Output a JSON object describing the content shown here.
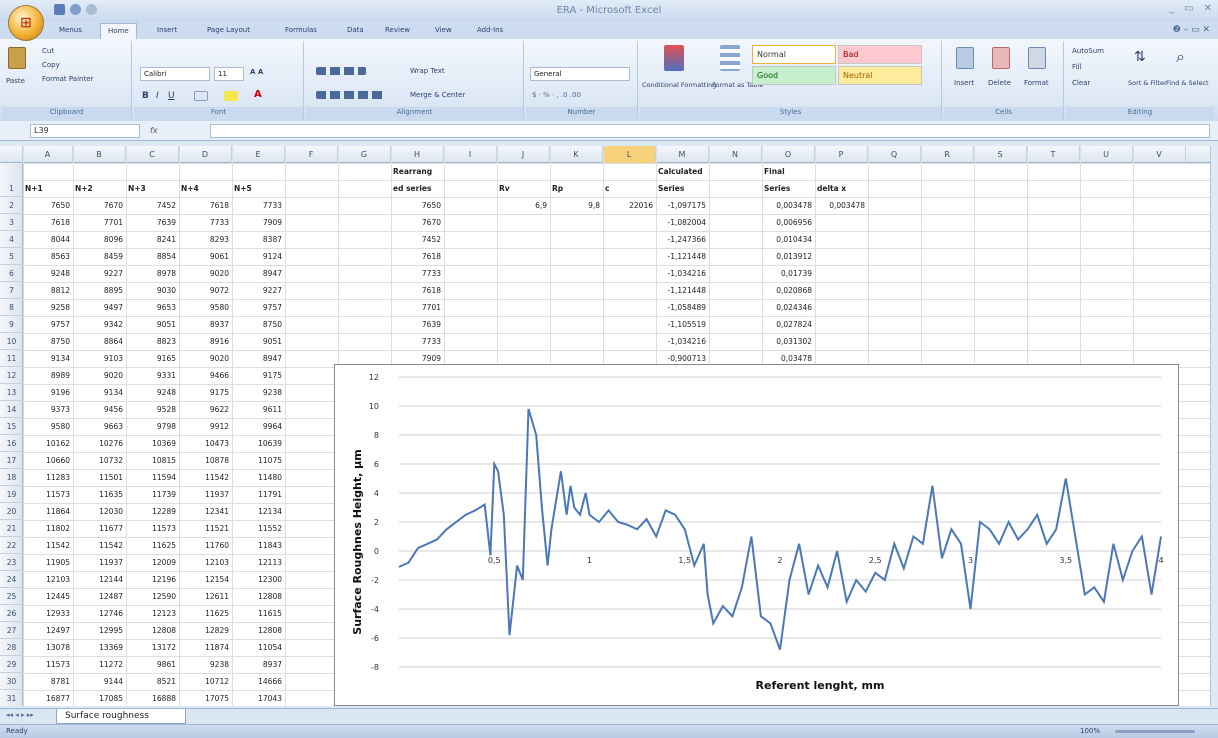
{
  "window": {
    "title": "ERA - Microsoft Excel"
  },
  "tabs": [
    "Menus",
    "Home",
    "Insert",
    "Page Layout",
    "Formulas",
    "Data",
    "Review",
    "View",
    "Add-Ins"
  ],
  "ribbon": {
    "clipboard": {
      "paste": "Paste",
      "cut": "Cut",
      "copy": "Copy",
      "format_painter": "Format Painter",
      "label": "Clipboard"
    },
    "font": {
      "name": "Calibri",
      "size": "11",
      "label": "Font"
    },
    "alignment": {
      "wrap": "Wrap Text",
      "merge": "Merge & Center",
      "label": "Alignment"
    },
    "number": {
      "format": "General",
      "label": "Number"
    },
    "styles": {
      "conditional": "Conditional Formatting",
      "format_table": "Format as Table",
      "normal": "Normal",
      "bad": "Bad",
      "good": "Good",
      "neutral": "Neutral",
      "label": "Styles"
    },
    "cells": {
      "insert": "Insert",
      "delete": "Delete",
      "format": "Format",
      "label": "Cells"
    },
    "editing": {
      "autosum": "AutoSum",
      "fill": "Fill",
      "clear": "Clear",
      "sort": "Sort & Filter",
      "find": "Find & Select",
      "label": "Editing"
    }
  },
  "formula_bar": {
    "name_box": "L39",
    "fx": "fx",
    "formula": ""
  },
  "columns": [
    "A",
    "B",
    "C",
    "D",
    "E",
    "F",
    "G",
    "H",
    "I",
    "J",
    "K",
    "L",
    "M",
    "N",
    "O",
    "P",
    "Q",
    "R",
    "S",
    "T",
    "U",
    "V"
  ],
  "headers": {
    "A": "N+1",
    "B": "N+2",
    "C": "N+3",
    "D": "N+4",
    "E": "N+5",
    "H1": "Rearrang",
    "H2": "ed series",
    "J": "Rv",
    "K": "Rp",
    "L": "c",
    "M1": "Calculated",
    "M2": "Series",
    "O1": "Final",
    "O2": "Series",
    "P": "delta x"
  },
  "table": [
    [
      7650,
      7670,
      7452,
      7618,
      7733
    ],
    [
      7618,
      7701,
      7639,
      7733,
      7909
    ],
    [
      8044,
      8096,
      8241,
      8293,
      8387
    ],
    [
      8563,
      8459,
      8854,
      9061,
      9124
    ],
    [
      9248,
      9227,
      8978,
      9020,
      8947
    ],
    [
      8812,
      8895,
      9030,
      9072,
      9227
    ],
    [
      9258,
      9497,
      9653,
      9580,
      9757
    ],
    [
      9757,
      9342,
      9051,
      8937,
      8750
    ],
    [
      8750,
      8864,
      8823,
      8916,
      9051
    ],
    [
      9134,
      9103,
      9165,
      9020,
      8947
    ],
    [
      8989,
      9020,
      9331,
      9466,
      9175
    ],
    [
      9196,
      9134,
      9248,
      9175,
      9238
    ],
    [
      9373,
      9456,
      9528,
      9622,
      9611
    ],
    [
      9580,
      9663,
      9798,
      9912,
      9964
    ],
    [
      10162,
      10276,
      10369,
      10473,
      10639
    ],
    [
      10660,
      10732,
      10815,
      10878,
      11075
    ],
    [
      11283,
      11501,
      11594,
      11542,
      11480
    ],
    [
      11573,
      11635,
      11739,
      11937,
      11791
    ],
    [
      11864,
      12030,
      12289,
      12341,
      12134
    ],
    [
      11802,
      11677,
      11573,
      11521,
      11552
    ],
    [
      11542,
      11542,
      11625,
      11760,
      11843
    ],
    [
      11905,
      11937,
      12009,
      12103,
      12113
    ],
    [
      12103,
      12144,
      12196,
      12154,
      12300
    ],
    [
      12445,
      12487,
      12590,
      12611,
      12808
    ],
    [
      12933,
      12746,
      12123,
      11625,
      11615
    ],
    [
      12497,
      12995,
      12808,
      12829,
      12808
    ],
    [
      13078,
      13369,
      13172,
      11874,
      11054
    ],
    [
      11573,
      11272,
      9861,
      9238,
      8937
    ],
    [
      8781,
      9144,
      8521,
      10712,
      14666
    ],
    [
      16877,
      17085,
      16888,
      17075,
      17043
    ]
  ],
  "col_h": [
    7650,
    7670,
    7452,
    7618,
    7733,
    7618,
    7701,
    7639,
    7733,
    7909
  ],
  "col_j": "6,9",
  "col_k": "9,8",
  "col_l": "22016",
  "col_m": [
    "-1,097175",
    "-1,082004",
    "-1,247366",
    "-1,121448",
    "-1,034216",
    "-1,121448",
    "-1,058489",
    "-1,105519",
    "-1,034216",
    "-0,900713"
  ],
  "col_o": [
    "0,003478",
    "0,006956",
    "0,010434",
    "0,013912",
    "0,01739",
    "0,020868",
    "0,024346",
    "0,027824",
    "0,031302",
    "0,03478"
  ],
  "col_p": "0,003478",
  "sheet_tab": "Surface roughness",
  "status": "Ready",
  "zoom": "100%",
  "chart_data": {
    "type": "line",
    "xlabel": "Referent lenght, mm",
    "ylabel": "Surface Roughnes Height, µm",
    "xlim": [
      0,
      4
    ],
    "ylim": [
      -8,
      12
    ],
    "yticks": [
      "12",
      "10",
      "8",
      "6",
      "4",
      "2",
      "0",
      "-2",
      "-4",
      "-6",
      "-8"
    ],
    "xticks": [
      "0,5",
      "1",
      "1,5",
      "2",
      "2,5",
      "3",
      "3,5",
      "4"
    ],
    "grid": true,
    "series": [
      {
        "x": [
          0,
          0.05,
          0.1,
          0.15,
          0.2,
          0.25,
          0.3,
          0.35,
          0.4,
          0.45,
          0.48,
          0.5,
          0.52,
          0.55,
          0.58,
          0.62,
          0.65,
          0.68,
          0.72,
          0.75,
          0.78,
          0.8,
          0.85,
          0.88,
          0.9,
          0.92,
          0.95,
          0.98,
          1.0,
          1.05,
          1.1,
          1.15,
          1.2,
          1.25,
          1.3,
          1.35,
          1.4,
          1.45,
          1.5,
          1.55,
          1.6,
          1.62,
          1.65,
          1.7,
          1.75,
          1.8,
          1.85,
          1.9,
          1.95,
          2.0,
          2.05,
          2.1,
          2.15,
          2.2,
          2.25,
          2.3,
          2.35,
          2.4,
          2.45,
          2.5,
          2.55,
          2.6,
          2.65,
          2.7,
          2.75,
          2.8,
          2.85,
          2.9,
          2.95,
          3.0,
          3.05,
          3.1,
          3.15,
          3.2,
          3.25,
          3.3,
          3.35,
          3.4,
          3.45,
          3.5,
          3.55,
          3.6,
          3.65,
          3.7,
          3.75,
          3.8,
          3.85,
          3.9,
          3.95,
          4.0
        ],
        "y": [
          -1.1,
          -0.8,
          0.2,
          0.5,
          0.8,
          1.5,
          2.0,
          2.5,
          2.8,
          3.2,
          -0.3,
          6.0,
          5.5,
          2.5,
          -5.8,
          -1.0,
          -2.0,
          9.8,
          8.0,
          3.0,
          -1.0,
          1.5,
          5.5,
          2.5,
          4.5,
          3.0,
          2.5,
          4.0,
          2.5,
          2.0,
          2.8,
          2.0,
          1.8,
          1.5,
          2.2,
          1.0,
          2.8,
          2.5,
          1.5,
          -1.0,
          0.5,
          -3.0,
          -5.0,
          -3.8,
          -4.5,
          -2.5,
          1.0,
          -4.5,
          -5.0,
          -6.8,
          -2.0,
          0.5,
          -3.0,
          -1.0,
          -2.5,
          0.0,
          -3.5,
          -2.0,
          -2.8,
          -1.5,
          -2.0,
          0.5,
          -1.2,
          1.0,
          0.5,
          4.5,
          -0.5,
          1.5,
          0.5,
          -4.0,
          2.0,
          1.5,
          0.5,
          2.0,
          0.8,
          1.5,
          2.5,
          0.5,
          1.5,
          5.0,
          1.0,
          -3.0,
          -2.5,
          -3.5,
          0.5,
          -2.0,
          0.0,
          1.0,
          -3.0,
          1.0
        ]
      }
    ]
  }
}
